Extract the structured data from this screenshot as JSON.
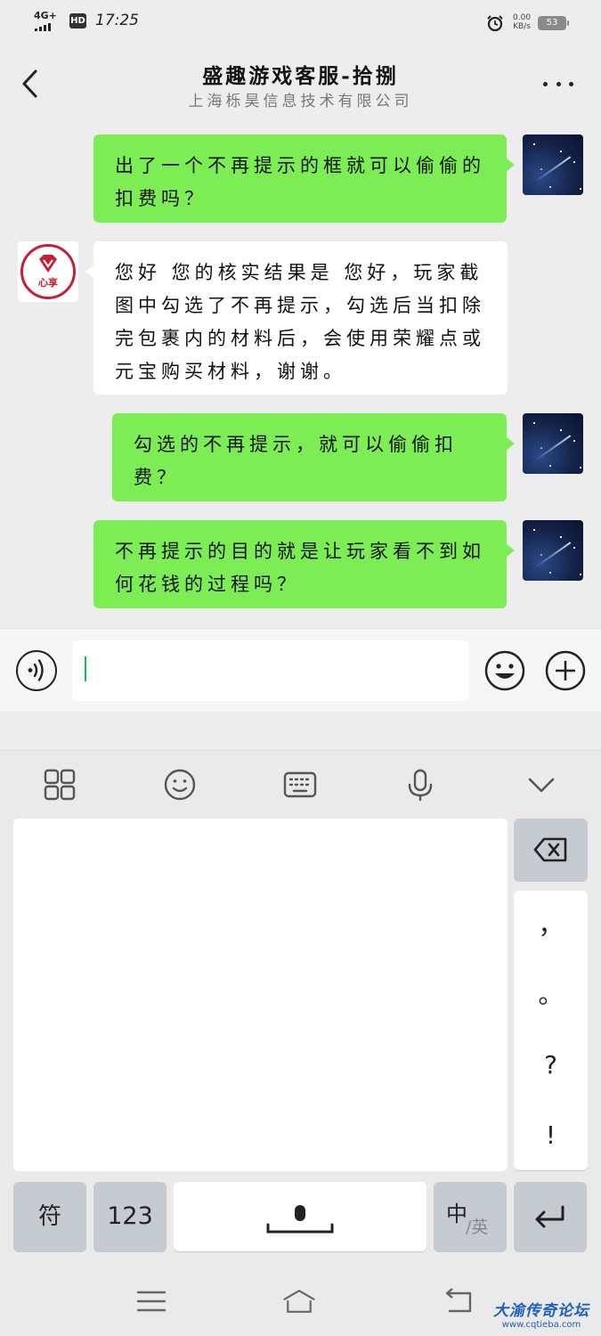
{
  "status_bar": {
    "network": "4G+",
    "hd_badge": "HD",
    "time": "17:25",
    "speed_value": "0.00",
    "speed_unit": "KB/s",
    "battery": "53"
  },
  "header": {
    "title": "盛趣游戏客服-拾捌",
    "subtitle": "上海栎昊信息技术有限公司"
  },
  "messages": [
    {
      "from": "me",
      "text": "出了一个不再提示的框就可以偷偷的扣费吗？"
    },
    {
      "from": "them",
      "text": "您好 您的核实结果是  您好，玩家截图中勾选了不再提示，勾选后当扣除完包裹内的材料后，会使用荣耀点或元宝购买材料，谢谢。"
    },
    {
      "from": "me",
      "text": "勾选的不再提示，就可以偷偷扣费？"
    },
    {
      "from": "me",
      "text": "不再提示的目的就是让玩家看不到如何花钱的过程吗？"
    }
  ],
  "agent_avatar_label": "心享",
  "input": {
    "value": "",
    "placeholder": ""
  },
  "keyboard": {
    "toolbar_icons": [
      "grid-icon",
      "smile-icon",
      "keyboard-icon",
      "mic-icon",
      "chevron-down-icon"
    ],
    "punctuation": [
      "，",
      "。",
      "?",
      "!"
    ],
    "symbol_key": "符",
    "number_key": "123",
    "lang_key_main": "中",
    "lang_key_alt": "/英"
  },
  "watermark": {
    "title": "大渝传奇论坛",
    "url": "www.cqtieba.com"
  }
}
